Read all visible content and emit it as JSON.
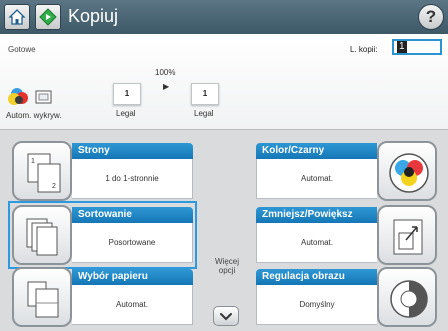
{
  "titlebar": {
    "title": "Kopiuj",
    "home_icon": "home-icon",
    "start_icon": "start-copy-icon",
    "help_label": "?"
  },
  "status": {
    "text": "Gotowe",
    "copies_label": "L. kopii:",
    "copies_value": "1",
    "zoom": "100%",
    "input_paper": {
      "count": "1",
      "size": "Legal"
    },
    "output_paper": {
      "count": "1",
      "size": "Legal"
    },
    "auto_label": "Autom. wykryw."
  },
  "tiles": {
    "sides": {
      "title": "Strony",
      "value": "1 do 1-stronnie",
      "icon": "sides-icon"
    },
    "collate": {
      "title": "Sortowanie",
      "value": "Posortowane",
      "icon": "collate-icon"
    },
    "paper": {
      "title": "Wybór papieru",
      "value": "Automat.",
      "icon": "paper-select-icon"
    },
    "color": {
      "title": "Kolor/Czarny",
      "value": "Automat.",
      "icon": "color-icon"
    },
    "reduce": {
      "title": "Zmniejsz/Powiększ",
      "value": "Automat.",
      "icon": "reduce-enlarge-icon"
    },
    "image": {
      "title": "Regulacja obrazu",
      "value": "Domyślny",
      "icon": "image-adjust-icon"
    }
  },
  "more": {
    "label": "Więcej opcji"
  },
  "colors": {
    "accent": "#1d86c6",
    "titlebar": "#4a6573",
    "selected": "#2d9ae0"
  }
}
